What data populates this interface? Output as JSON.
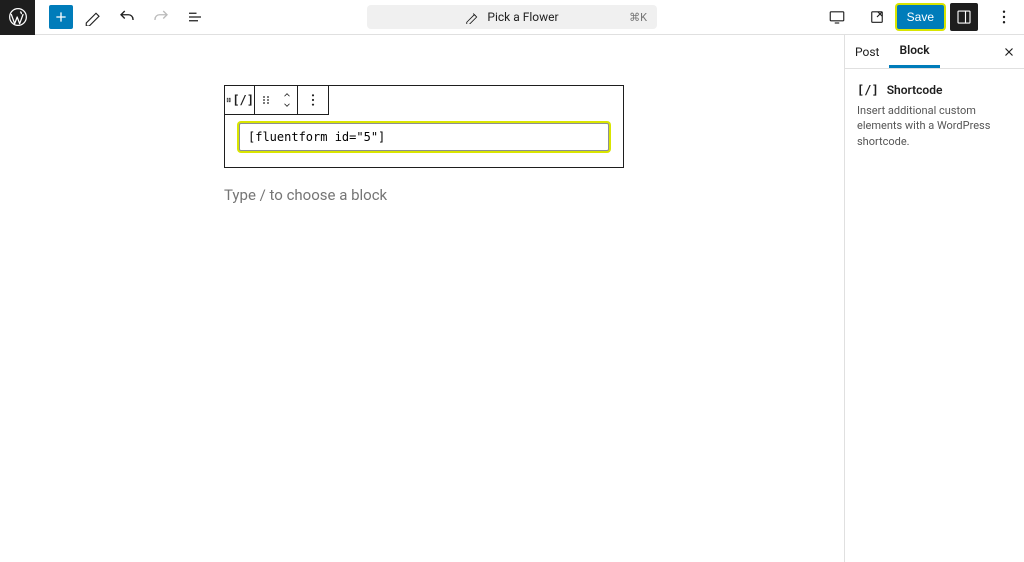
{
  "header": {
    "command_center_title": "Pick a Flower",
    "command_center_shortcut": "⌘K",
    "save_label": "Save"
  },
  "block_toolbar": {
    "block_type_icon": "shortcode-icon"
  },
  "block": {
    "label": "Shortcode",
    "value": "[fluentform id=\"5\"]"
  },
  "editor": {
    "placeholder_prompt": "Type / to choose a block"
  },
  "sidebar": {
    "tabs": {
      "post": "Post",
      "block": "Block"
    },
    "block_title": "Shortcode",
    "block_description": "Insert additional custom elements with a WordPress shortcode."
  }
}
